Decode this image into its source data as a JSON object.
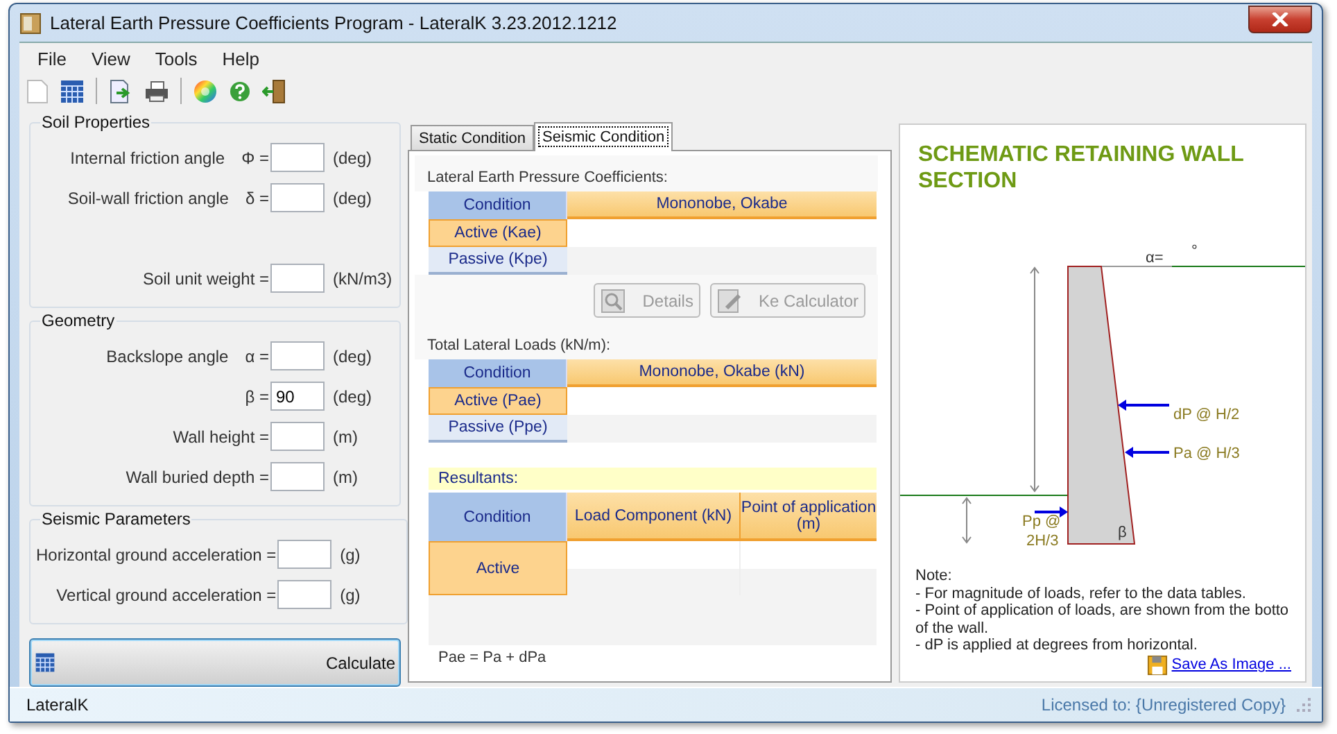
{
  "window": {
    "title": "Lateral Earth Pressure Coefficients Program - LateralK 3.23.2012.1212"
  },
  "menu": [
    "File",
    "View",
    "Tools",
    "Help"
  ],
  "groups": [
    {
      "title": "Soil Properties",
      "fields": [
        {
          "label": "Internal friction angle",
          "symbol": "Φ =",
          "unit": "(deg)"
        },
        {
          "label": "Soil-wall friction angle",
          "symbol": "δ =",
          "unit": "(deg)"
        },
        {
          "label": "Soil unit weight =",
          "unit": "(kN/m3)"
        }
      ]
    },
    {
      "title": "Geometry",
      "fields": [
        {
          "label": "Backslope angle",
          "symbol": "α =",
          "unit": "(deg)"
        },
        {
          "symbol": "β =",
          "value": "90",
          "unit": "(deg)"
        },
        {
          "label": "Wall height =",
          "unit": "(m)"
        },
        {
          "label": "Wall buried depth =",
          "unit": "(m)"
        }
      ]
    },
    {
      "title": "Seismic Parameters",
      "fields": [
        {
          "label": "Horizontal ground acceleration =",
          "unit": "(g)"
        },
        {
          "label": "Vertical ground acceleration =",
          "unit": "(g)"
        }
      ]
    }
  ],
  "calculate_button": "Calculate",
  "tabs": [
    {
      "label": "Static Condition",
      "selected": false
    },
    {
      "label": "Seismic Condition",
      "selected": true
    }
  ],
  "coefficients": {
    "title": "Lateral Earth Pressure Coefficients:",
    "columns": [
      "Condition",
      "Mononobe, Okabe"
    ],
    "rows": [
      "Active (Kae)",
      "Passive (Kpe)"
    ],
    "buttons": [
      {
        "label": "Details",
        "disabled": true
      },
      {
        "label": "Ke Calculator",
        "disabled": true
      }
    ]
  },
  "loads": {
    "title": "Total Lateral Loads (kN/m):",
    "columns": [
      "Condition",
      "Mononobe, Okabe (kN)"
    ],
    "rows": [
      "Active (Pae)",
      "Passive (Ppe)"
    ]
  },
  "resultants": {
    "title": "Resultants:",
    "columns": [
      "Condition",
      "Load Component (kN)",
      "Point of application (m)"
    ],
    "rows": [
      "Active"
    ],
    "formula": "Pae = Pa + dPa"
  },
  "schematic": {
    "title": "SCHEMATIC RETAINING WALL SECTION",
    "alpha_label": "α=",
    "degree_mark": "°",
    "dp_label": "dP @  H/2",
    "pa_label": "Pa @  H/3",
    "pp_label": "Pp @",
    "pp_position": "2H/3",
    "beta_label": "β",
    "notes": [
      "Note:",
      "- For magnitude of loads, refer to the data tables.",
      "- Point of application of loads, are shown from the botto",
      "of the wall.",
      "- dP is applied at  degrees from horizontal."
    ],
    "save_link": "Save As Image ..."
  },
  "status_bar": {
    "app": "LateralK",
    "license": "Licensed to: {Unregistered Copy}"
  }
}
